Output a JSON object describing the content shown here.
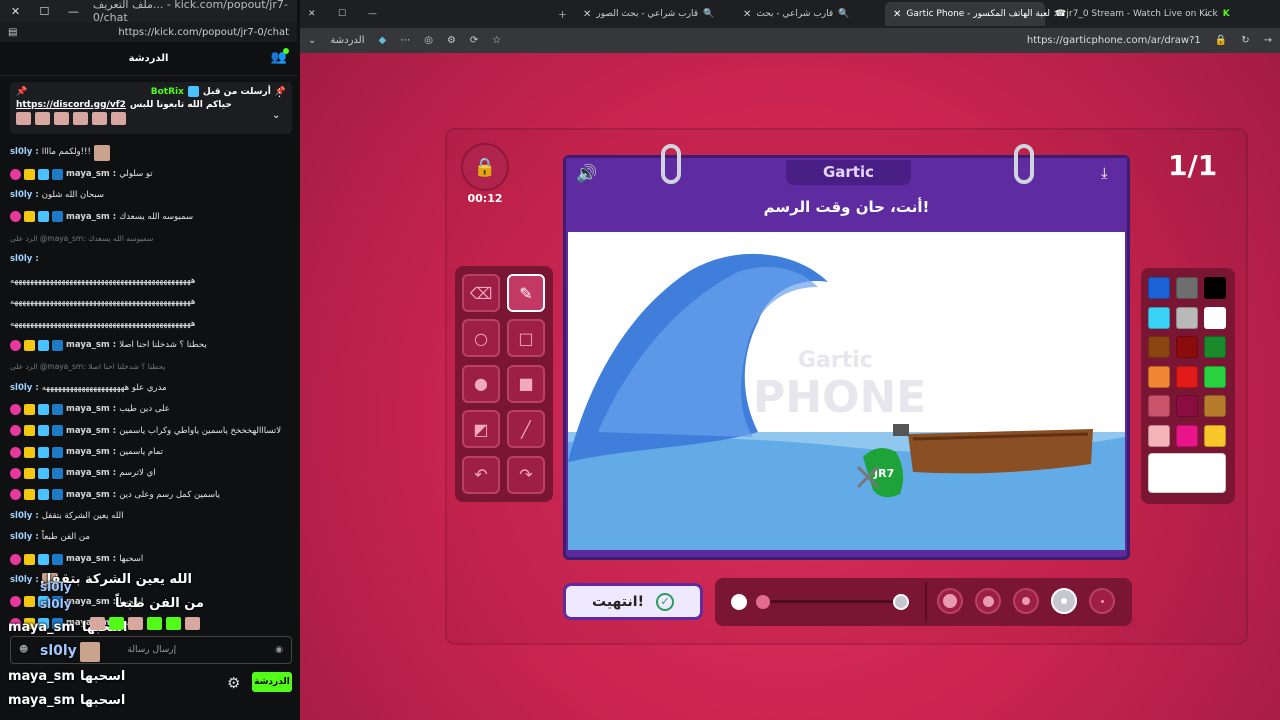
{
  "left_window": {
    "tab_title": "ملف التعريف... - kick.com/popout/jr7-0/chat",
    "url": "https://kick.com/popout/jr7-0/chat",
    "chat_header": "الدردشة",
    "pinned": {
      "user": "BotRix",
      "sent_by": "أرسلت من قبل",
      "text": "حياكم الله تابعونا للبس",
      "link": "https://discord.gg/vf2"
    },
    "messages": [
      {
        "user": "sl0ly",
        "text": "ولكمم ماااا!!!",
        "style": "u1",
        "badges": 0,
        "avatar": true
      },
      {
        "user": "maya_sm",
        "text": "تو سلولي",
        "style": "u2",
        "badges": 1
      },
      {
        "user": "sl0ly",
        "text": "سبحان الله شلون",
        "style": "u1",
        "badges": 0
      },
      {
        "user": "maya_sm",
        "text": "سمبوسه الله يسعدك",
        "style": "u2",
        "badges": 1
      },
      {
        "user": "",
        "text": "الرد على @maya_sm: سمبوسه الله يسعدك",
        "style": "rp",
        "badges": 0
      },
      {
        "user": "sl0ly",
        "text": "",
        "style": "u1",
        "badges": 0
      },
      {
        "user": "",
        "text": "ههههههههههههههههههههههههههههههههههههههههههههههه",
        "style": "ms",
        "badges": 0
      },
      {
        "user": "",
        "text": "ههههههههههههههههههههههههههههههههههههههههههههههه",
        "style": "ms",
        "badges": 0
      },
      {
        "user": "",
        "text": "ههههههههههههههههههههههههههههههههههههههههههههههه",
        "style": "ms",
        "badges": 0
      },
      {
        "user": "maya_sm",
        "text": "يحطنا ؟ شدخلنا احنا اصلا",
        "style": "u2",
        "badges": 1
      },
      {
        "user": "",
        "text": "الرد على @maya_sm: يحطنا ؟ شدخلنا احنا اصلا",
        "style": "rp",
        "badges": 0
      },
      {
        "user": "sl0ly",
        "text": "مدري علو هههههههههههههههههههههه",
        "style": "u1",
        "badges": 0
      },
      {
        "user": "maya_sm",
        "text": "على دين طيب",
        "style": "u2",
        "badges": 1
      },
      {
        "user": "maya_sm",
        "text": "لاتسااالهخخخخ ياسمين ياواطي وكراب ياسمين",
        "style": "u2",
        "badges": 1
      },
      {
        "user": "maya_sm",
        "text": "تمام ياسمين",
        "style": "u2",
        "badges": 1
      },
      {
        "user": "maya_sm",
        "text": "اي لاترسم",
        "style": "u2",
        "badges": 1
      },
      {
        "user": "maya_sm",
        "text": "ياسمين كمل رسم وعلى دين",
        "style": "u2",
        "badges": 1
      },
      {
        "user": "sl0ly",
        "text": "الله يعين الشركة بتقفل",
        "style": "u1",
        "badges": 0
      },
      {
        "user": "sl0ly",
        "text": "من الفن طبعاً",
        "style": "u1",
        "badges": 0
      },
      {
        "user": "maya_sm",
        "text": "اسحبها",
        "style": "u2",
        "badges": 1
      },
      {
        "user": "sl0ly",
        "text": "",
        "style": "u1",
        "badges": 0,
        "avatar": true
      },
      {
        "user": "maya_sm",
        "text": "اسحبها",
        "style": "u2",
        "badges": 1
      },
      {
        "user": "maya_sm",
        "text": "اسحبها",
        "style": "u2",
        "badges": 1
      }
    ],
    "overlay": {
      "line1_text": "الله يعين الشركة بتقفل",
      "line1_user": "sl0ly",
      "line2_text": "من الفن طبعاً",
      "line2_user": "sl0ly",
      "line3_user": "maya_sm",
      "line3_text": "اسحبها",
      "line4_user": "sl0ly",
      "line5_user": "maya_sm",
      "line5_text": "اسحبها",
      "line6_user": "maya_sm",
      "line6_text": "اسحبها"
    },
    "input_placeholder": "إرسال رسالة",
    "send_label": "الدردشة"
  },
  "browser": {
    "tabs": [
      {
        "title": "قارب شراعي - بحث الصور",
        "active": false
      },
      {
        "title": "قارب شراعي - بحث",
        "active": false
      },
      {
        "title": "Gartic Phone - لعبة الهاتف المكسور",
        "active": true
      },
      {
        "title": "jr7_0 Stream - Watch Live on Kick",
        "active": false
      }
    ],
    "sidebar_label": "الدردشة",
    "url": "https://garticphone.com/ar/draw?1"
  },
  "game": {
    "timer": "00:12",
    "round": "1/1",
    "logo": "Gartic",
    "prompt": "أنت، حان وقت الرسم!",
    "done_label": "انتهيت!",
    "colors": [
      "#1b62d6",
      "#6e6e6e",
      "#000000",
      "#3ad3f5",
      "#b9b9b9",
      "#ffffff",
      "#8b4513",
      "#8a0c0c",
      "#1a8a2c",
      "#f08534",
      "#e11a1a",
      "#27d13f",
      "#c9536a",
      "#8a0c40",
      "#b77b2c",
      "#f3b3b9",
      "#ea1489",
      "#f7c62a"
    ],
    "selected_color": "#ffffff",
    "canvas_label_text": "JR7"
  }
}
